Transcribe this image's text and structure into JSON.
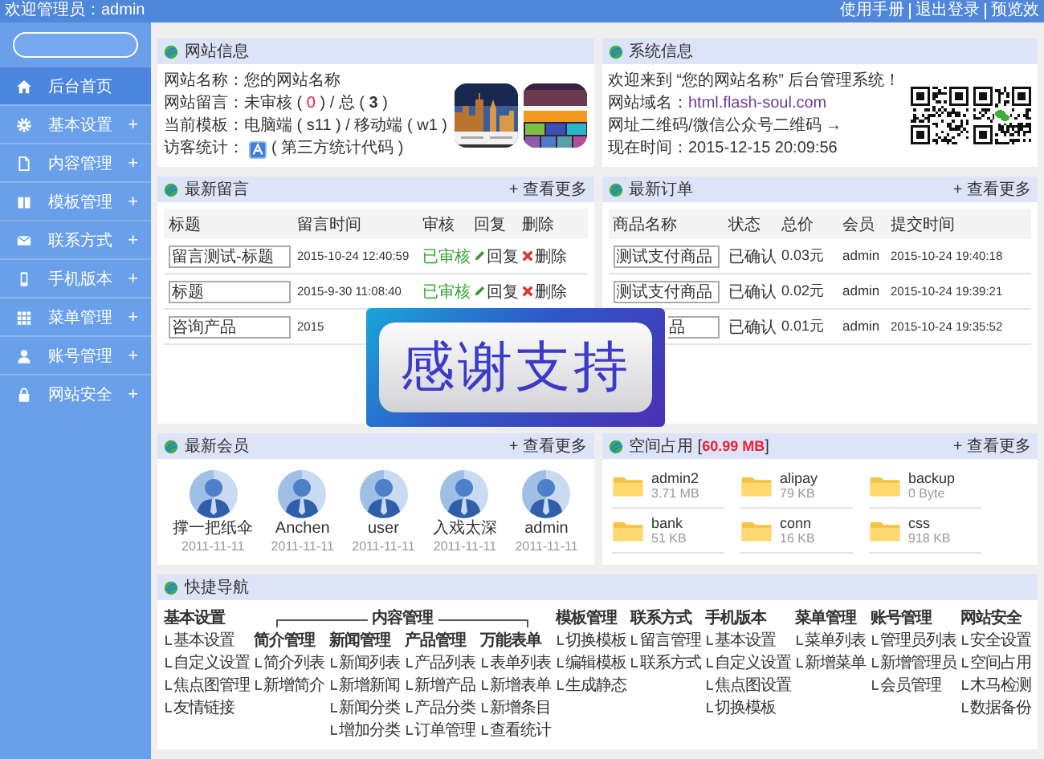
{
  "topbar": {
    "welcome": "欢迎管理员：admin",
    "links": [
      "使用手册",
      "退出登录",
      "预览效"
    ]
  },
  "sidebar": {
    "items": [
      {
        "label": "后台首页",
        "selected": true
      },
      {
        "label": "基本设置",
        "selected": false,
        "toggle": "+"
      },
      {
        "label": "内容管理",
        "selected": false,
        "toggle": "+"
      },
      {
        "label": "模板管理",
        "selected": false,
        "toggle": "+"
      },
      {
        "label": "联系方式",
        "selected": false,
        "toggle": "+"
      },
      {
        "label": "手机版本",
        "selected": false,
        "toggle": "+"
      },
      {
        "label": "菜单管理",
        "selected": false,
        "toggle": "+"
      },
      {
        "label": "账号管理",
        "selected": false,
        "toggle": "+"
      },
      {
        "label": "网站安全",
        "selected": false,
        "toggle": "+"
      }
    ]
  },
  "site_info": {
    "title": "网站信息",
    "lines": [
      {
        "kind": "text",
        "parts": [
          {
            "text": "网站名称：您的网站名称"
          }
        ]
      },
      {
        "kind": "text",
        "parts": [
          {
            "text": "网站留言：未审核 ( "
          },
          {
            "text": "0",
            "kind": "alert"
          },
          {
            "text": " ) / 总 ( "
          },
          {
            "text": "3",
            "kind": "strong"
          },
          {
            "text": " )"
          }
        ]
      },
      {
        "kind": "text",
        "parts": [
          {
            "text": "当前模板：电脑端 ( s11 ) / 移动端 ( w1 )"
          }
        ]
      },
      {
        "kind": "stats",
        "label": "访客统计：",
        "note": "( 第三方统计代码 )"
      }
    ]
  },
  "system_info": {
    "title": "系统信息",
    "lines": [
      {
        "kind": "text",
        "parts": [
          {
            "text": "欢迎来到 “您的网站名称” 后台管理系统！"
          }
        ]
      },
      {
        "kind": "text",
        "parts": [
          {
            "text": "网站域名："
          },
          {
            "text": "html.flash-soul.com",
            "kind": "link"
          }
        ]
      },
      {
        "kind": "text",
        "parts": [
          {
            "text": "网址二维码/微信公众号二维码 →"
          }
        ]
      },
      {
        "kind": "text",
        "parts": [
          {
            "text": "现在时间：2015-12-15 20:09:56"
          }
        ]
      }
    ]
  },
  "messages": {
    "title": "最新留言",
    "more": "+ 查看更多",
    "columns": [
      "标题",
      "留言时间",
      "审核",
      "回复",
      "删除"
    ],
    "rows": [
      {
        "title": "留言测试-标题",
        "time": "2015-10-24 12:40:59",
        "status": "已审核",
        "reply": "回复",
        "delete": "删除"
      },
      {
        "title": "标题",
        "time": "2015-9-30 11:08:40",
        "status": "已审核",
        "reply": "回复",
        "delete": "删除"
      },
      {
        "title": "咨询产品",
        "time": "2015"
      }
    ]
  },
  "orders": {
    "title": "最新订单",
    "more": "+ 查看更多",
    "columns": [
      "商品名称",
      "状态",
      "总价",
      "会员",
      "提交时间"
    ],
    "rows": [
      {
        "name": "测试支付商品",
        "status": "已确认",
        "price": "0.03元",
        "member": "admin",
        "time": "2015-10-24 19:40:18"
      },
      {
        "name": "测试支付商品",
        "status": "已确认",
        "price": "0.02元",
        "member": "admin",
        "time": "2015-10-24 19:39:21"
      },
      {
        "name": "品",
        "status": "已确认",
        "price": "0.01元",
        "member": "admin",
        "time": "2015-10-24 19:35:52"
      }
    ]
  },
  "members": {
    "title": "最新会员",
    "more": "+ 查看更多",
    "items": [
      {
        "name": "撑一把纸伞",
        "date": "2011-11-11"
      },
      {
        "name": "Anchen",
        "date": "2011-11-11"
      },
      {
        "name": "user",
        "date": "2011-11-11"
      },
      {
        "name": "入戏太深",
        "date": "2011-11-11"
      },
      {
        "name": "admin",
        "date": "2011-11-11"
      }
    ]
  },
  "storage": {
    "title": "空间占用 [",
    "usage": "60.99 MB",
    "title_end": "]",
    "more": "+ 查看更多",
    "folders": [
      {
        "name": "admin2",
        "size": "3.71 MB"
      },
      {
        "name": "alipay",
        "size": "79 KB"
      },
      {
        "name": "backup",
        "size": "0 Byte"
      },
      {
        "name": "bank",
        "size": "51 KB"
      },
      {
        "name": "conn",
        "size": "16 KB"
      },
      {
        "name": "css",
        "size": "918 KB"
      }
    ]
  },
  "banner": {
    "text": "感谢支持"
  },
  "quick_nav": {
    "title": "快捷导航",
    "groups": [
      {
        "kind": "section",
        "title": "基本设置",
        "items": [
          "基本设置",
          "自定义设置",
          "焦点图管理",
          "友情链接"
        ]
      },
      {
        "kind": "group",
        "title": "内容管理",
        "sections": [
          {
            "title": "简介管理",
            "items": [
              "简介列表",
              "新增简介"
            ]
          },
          {
            "title": "新闻管理",
            "items": [
              "新闻列表",
              "新增新闻",
              "新闻分类",
              "增加分类"
            ]
          },
          {
            "title": "产品管理",
            "items": [
              "产品列表",
              "新增产品",
              "产品分类",
              "订单管理"
            ]
          },
          {
            "title": "万能表单",
            "items": [
              "表单列表",
              "新增表单",
              "新增条目",
              "查看统计"
            ]
          }
        ]
      },
      {
        "kind": "section",
        "title": "模板管理",
        "items": [
          "切换模板",
          "编辑模板",
          "生成静态"
        ]
      },
      {
        "kind": "section",
        "title": "联系方式",
        "items": [
          "留言管理",
          "联系方式"
        ]
      },
      {
        "kind": "section",
        "title": "手机版本",
        "items": [
          "基本设置",
          "自定义设置",
          "焦点图设置",
          "切换模板"
        ]
      },
      {
        "kind": "section",
        "title": "菜单管理",
        "items": [
          "菜单列表",
          "新增菜单"
        ]
      },
      {
        "kind": "section",
        "title": "账号管理",
        "items": [
          "管理员列表",
          "新增管理员",
          "会员管理"
        ]
      },
      {
        "kind": "section",
        "title": "网站安全",
        "items": [
          "安全设置",
          "空间占用",
          "木马检测",
          "数据备份"
        ]
      }
    ]
  }
}
